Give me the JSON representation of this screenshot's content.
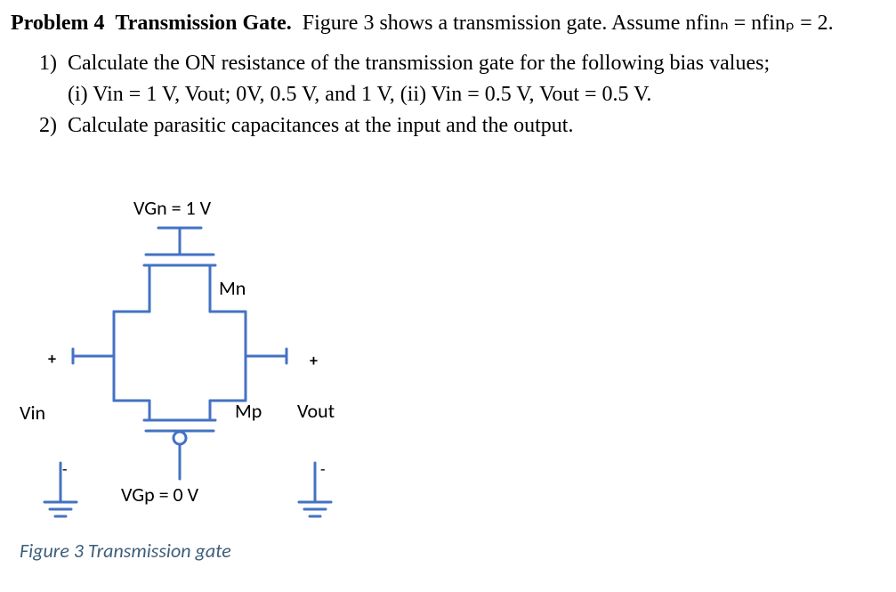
{
  "title": {
    "problem_label": "Problem 4",
    "problem_name": "Transmission Gate.",
    "intro": "Figure 3 shows a transmission gate. Assume nfinₙ = nfinₚ = 2."
  },
  "list": {
    "n1": "1)",
    "n2": "2)",
    "item1_text": "Calculate the ON resistance of the transmission gate for the following bias values;",
    "item1_sub": "(i)       Vin = 1 V, Vout; 0V, 0.5 V, and 1 V, (ii) Vin = 0.5 V, Vout = 0.5 V.",
    "item2_text": "Calculate parasitic capacitances at the input and the output."
  },
  "fig": {
    "vgn": "VGn = 1 V",
    "vgp": "VGp = 0 V",
    "mn": "Mn",
    "mp": "Mp",
    "vin": "Vin",
    "vout": "Vout",
    "plus": "+",
    "minus_l": "-",
    "minus_r": "-",
    "caption_num": "Figure 3",
    "caption_txt": "  Transmission gate"
  }
}
